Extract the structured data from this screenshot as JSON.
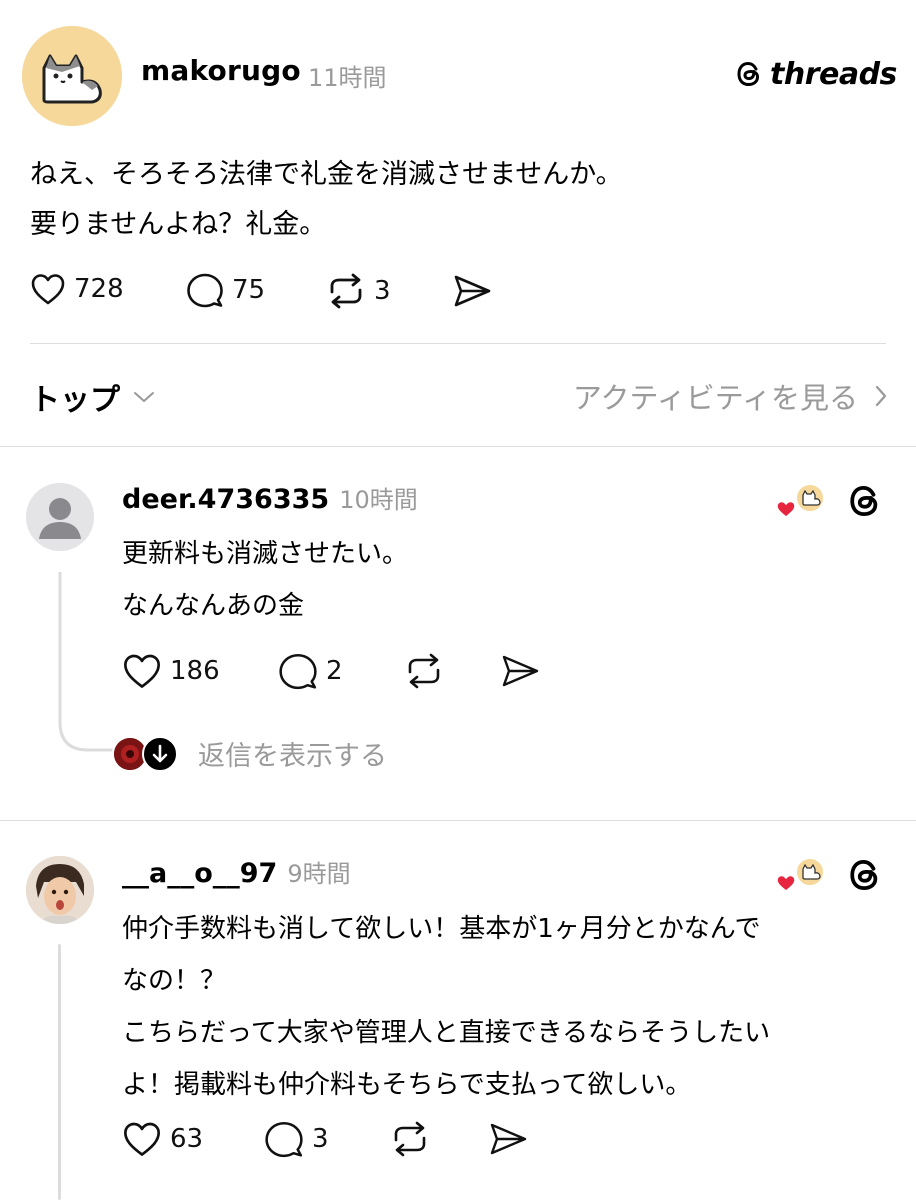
{
  "brand": {
    "name": "threads",
    "icon": "threads-logo-icon"
  },
  "post": {
    "username": "makorugo",
    "time": "11時間",
    "lines": [
      "ねえ、そろそろ法律で礼金を消滅させませんか。",
      "要りませんよね？礼金。"
    ],
    "likes": "728",
    "replies": "75",
    "reposts": "3"
  },
  "sort": {
    "label": "トップ",
    "activity_label": "アクティビティを見る"
  },
  "replies": [
    {
      "username": "deer.4736335",
      "time": "10時間",
      "lines": [
        "更新料も消滅させたい。",
        "なんなんあの金"
      ],
      "likes": "186",
      "replies": "2",
      "show_replies": "返信を表示する"
    },
    {
      "username": "__a__o__97",
      "time": "9時間",
      "lines": [
        "仲介手数料も消して欲しい！基本が1ヶ月分とかなんで",
        "なの！？",
        "こちらだって大家や管理人と直接できるならそうしたい",
        "よ！掲載料も仲介料もそちらで支払って欲しい。"
      ],
      "likes": "63",
      "replies": "3"
    }
  ],
  "colors": {
    "accent_heart": "#e8253f",
    "muted": "#9a9a9a",
    "avatar_bg": "#f6d99a"
  }
}
